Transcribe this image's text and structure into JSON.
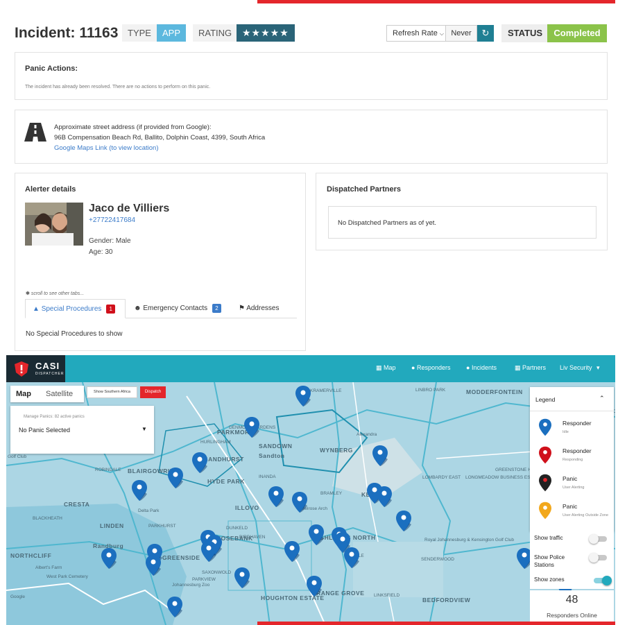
{
  "incident": {
    "title": "Incident: 11163",
    "type_label": "TYPE",
    "type_value": "APP",
    "rating_label": "RATING",
    "rating_value": "★★★★★",
    "rating_stars": 5,
    "refresh_label": "Refresh Rate",
    "refresh_value": "Never",
    "status_label": "STATUS",
    "status_value": "Completed"
  },
  "panic_actions": {
    "title": "Panic Actions:",
    "message": "The incident has already been resolved. There are no actions to perform on this panic."
  },
  "address": {
    "line1": "Approximate street address (if provided from Google):",
    "line2": "96B Compensation Beach Rd, Ballito, Dolphin Coast, 4399, South Africa",
    "link": "Google Maps Link (to view location)"
  },
  "alerter": {
    "title": "Alerter details",
    "name": "Jaco de Villiers",
    "phone": "+27722417684",
    "gender": "Gender: Male",
    "age": "Age: 30",
    "scroll_hint": "scroll to see other tabs...",
    "tabs": [
      {
        "label": "Special Procedures",
        "badge": "1"
      },
      {
        "label": "Emergency Contacts",
        "badge": "2"
      },
      {
        "label": "Addresses",
        "badge": ""
      }
    ],
    "empty_message": "No Special Procedures to show"
  },
  "dispatched": {
    "title": "Dispatched Partners",
    "message": "No Dispatched Partners as of yet."
  },
  "navbar": {
    "logo": "CASI",
    "logo_sub": "DISPATCHER",
    "items": [
      "Map",
      "Responders",
      "Incidents",
      "Partners",
      "Liv Security"
    ]
  },
  "map": {
    "type_map": "Map",
    "type_satellite": "Satellite",
    "show_southern": "Show Southern Africa",
    "dispatch": "Dispatch",
    "manage_label": "Manage Panics: 82 active panics",
    "panic_select": "No Panic Selected",
    "labels": [
      "MODDERFONTEIN",
      "LINBRO PARK",
      "KRAMERVILLE",
      "PARKMORE",
      "SANDOWN",
      "Sandton",
      "WYNBERG",
      "Alexandra",
      "SANDHURST",
      "BLAIRGOWRIE",
      "HYDE PARK",
      "INANDA",
      "LOMBARDY EAST",
      "LONGMEADOW BUSINESS ESTATE",
      "GREENSTONE HILL",
      "KEW",
      "BRAMLEY",
      "CRESTA",
      "LINDEN",
      "PARKHURST",
      "ILLOVO",
      "Melrose Arch",
      "BLACKHEATH",
      "ROSEBANK",
      "DUNKELD",
      "BIRDHAVEN",
      "HIGHLANDS NORTH",
      "NORTHCLIFF",
      "Randburg",
      "SAXONWOLD",
      "PARKVIEW",
      "HOUGHTON ESTATE",
      "ORANGE GROVE",
      "LINKSFIELD",
      "BEDFORDVIEW",
      "SENDERWOOD",
      "Royal Johannesburg & Kensington Golf Club",
      "Johannesburg Zoo",
      "West Park Cemetery",
      "Albert's Farm",
      "Delta Park",
      "Golf Club",
      "Google",
      "DENMORE GARDENS",
      "HURLINGHAM",
      "ROBINDALE",
      "EDENVALE",
      "RAVENSWOOD",
      "GREENSIDE",
      "VILLE"
    ],
    "legend": {
      "title": "Legend",
      "items": [
        {
          "name": "Responder",
          "sub": "Idle",
          "color": "#1b6fbf"
        },
        {
          "name": "Responder",
          "sub": "Responding",
          "color": "#d0101b"
        },
        {
          "name": "Panic",
          "sub": "User Alerting",
          "color": "#222222"
        },
        {
          "name": "Panic",
          "sub": "User Alerting Outside Zone",
          "color": "#f2a81d"
        }
      ]
    },
    "toggles": [
      {
        "label": "Show traffic",
        "on": false
      },
      {
        "label": "Show Police Stations",
        "on": false
      },
      {
        "label": "Show zones",
        "on": true
      }
    ],
    "responders_online_count": "48",
    "responders_online_label": "Responders Online"
  },
  "colors": {
    "accent": "#22a9bd",
    "brand_red": "#e4262b",
    "status_green": "#8bc34a",
    "link_blue": "#3b7bc9"
  }
}
